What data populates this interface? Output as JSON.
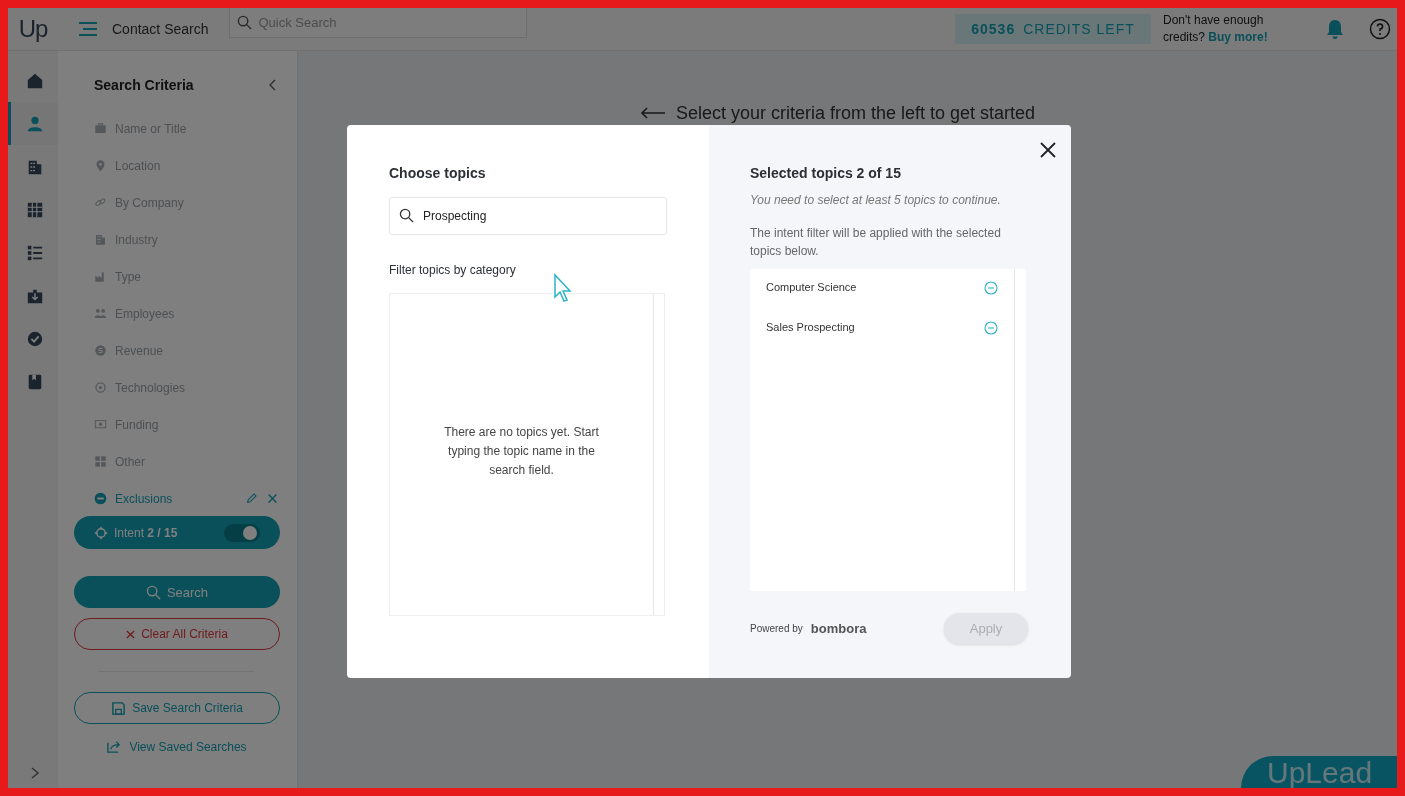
{
  "topbar": {
    "logo": "Up",
    "title": "Contact Search",
    "search": {
      "placeholder": "Quick Search"
    },
    "credits": {
      "count": "60536",
      "label": "CREDITS LEFT"
    },
    "promo_text": "Don't have enough credits?",
    "promo_link": "Buy more!"
  },
  "rail": [
    {
      "kind": "home",
      "selected": false
    },
    {
      "kind": "person",
      "selected": true
    },
    {
      "kind": "building",
      "selected": false
    },
    {
      "kind": "table",
      "selected": false
    },
    {
      "kind": "list",
      "selected": false
    },
    {
      "kind": "download",
      "selected": false
    },
    {
      "kind": "check",
      "selected": false
    },
    {
      "kind": "book",
      "selected": false
    }
  ],
  "sidebar": {
    "title": "Search Criteria",
    "criteria": [
      {
        "label": "Name or Title",
        "kind": "briefcase"
      },
      {
        "label": "Location",
        "kind": "pin"
      },
      {
        "label": "By Company",
        "kind": "link"
      },
      {
        "label": "Industry",
        "kind": "building"
      },
      {
        "label": "Type",
        "kind": "factory"
      },
      {
        "label": "Employees",
        "kind": "people"
      },
      {
        "label": "Revenue",
        "kind": "coin"
      },
      {
        "label": "Technologies",
        "kind": "gear"
      },
      {
        "label": "Funding",
        "kind": "cash"
      },
      {
        "label": "Other",
        "kind": "tiles"
      }
    ],
    "exclusions": {
      "label": "Exclusions"
    },
    "intent": {
      "label": "Intent **2 / 15**",
      "on": true
    },
    "search_button": "Search",
    "clear_button": "Clear All Criteria",
    "save_button": "Save Search Criteria",
    "saved_link": "View Saved Searches"
  },
  "main": {
    "hint": "Select your criteria from the left to get started"
  },
  "modal": {
    "left": {
      "title": "Choose topics",
      "search": {
        "value": "Prospecting"
      },
      "filter_label": "Filter topics by category",
      "empty_message": "There are no topics yet. Start typing the topic name in the search field."
    },
    "right": {
      "title": "Selected topics 2 of 15",
      "note": "You need to select at least 5 topics to continue.",
      "description": "The intent filter will be applied with the selected topics below.",
      "topics": [
        {
          "label": "Computer Science"
        },
        {
          "label": "Sales Prospecting"
        }
      ],
      "powered_by": "Powered by",
      "brand": "bombora",
      "apply": {
        "label": "Apply",
        "disabled": true
      }
    }
  },
  "chat_widget": {
    "label": "UpLead"
  }
}
